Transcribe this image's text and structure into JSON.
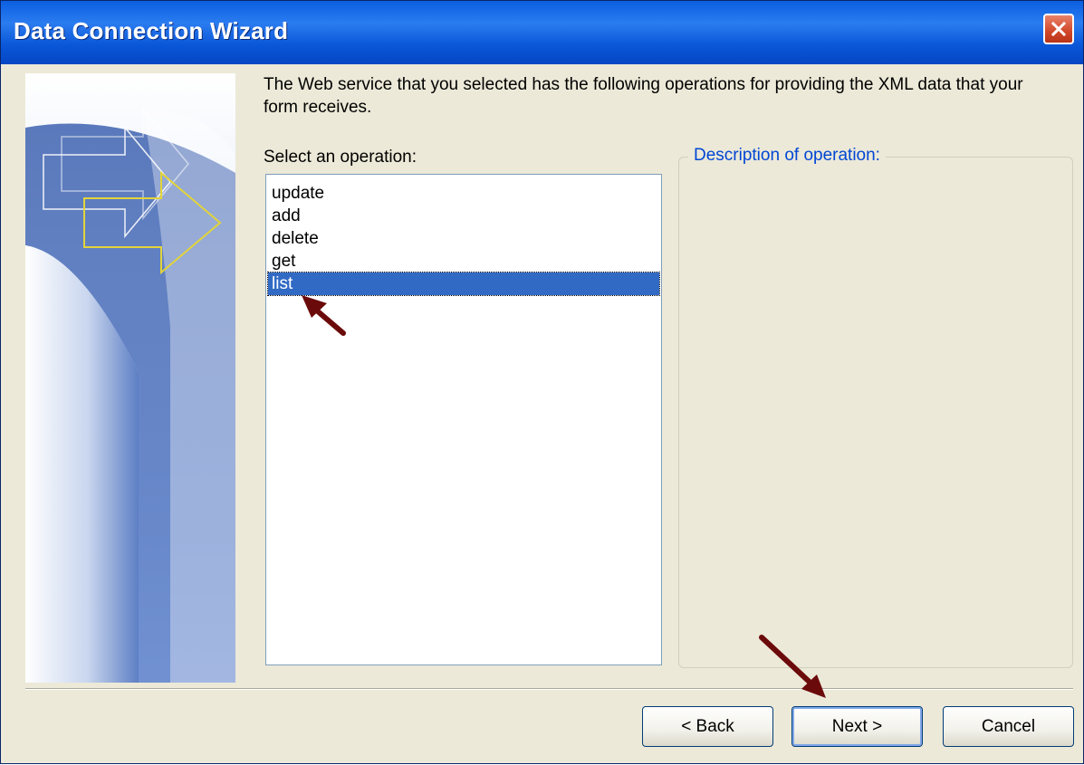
{
  "window": {
    "title": "Data Connection Wizard",
    "close_icon": "close-icon",
    "colors": {
      "titlebar": "#0a57d8",
      "close": "#d2472a",
      "selection": "#316ac5",
      "group_label": "#0046d5"
    }
  },
  "main": {
    "intro": "The Web service that you selected has the following operations for providing the XML data that your form receives.",
    "select_label": "Select an operation:",
    "operations": [
      "update",
      "add",
      "delete",
      "get",
      "list"
    ],
    "selected_operation": "list",
    "description_label": "Description of operation:"
  },
  "buttons": {
    "back": "< Back",
    "next": "Next >",
    "cancel": "Cancel"
  },
  "annotations": [
    "arrow-icon",
    "arrow-icon"
  ]
}
